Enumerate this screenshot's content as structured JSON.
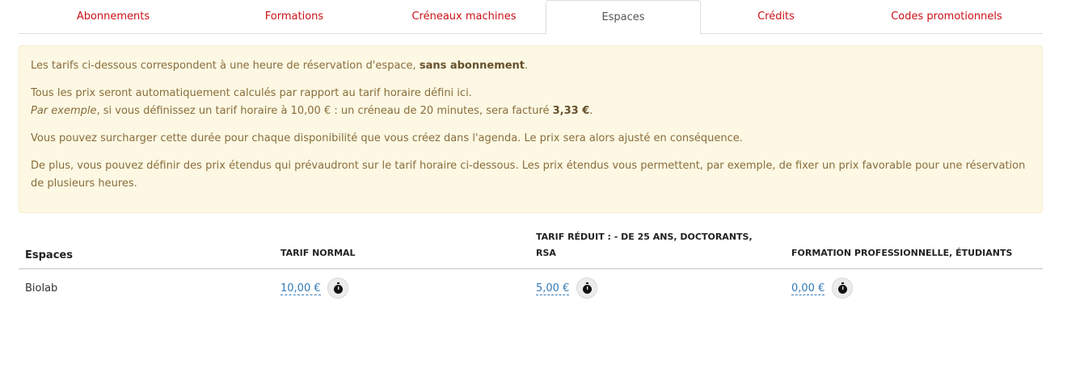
{
  "tabs": [
    {
      "label": "Abonnements",
      "active": false
    },
    {
      "label": "Formations",
      "active": false
    },
    {
      "label": "Créneaux machines",
      "active": false
    },
    {
      "label": "Espaces",
      "active": true
    },
    {
      "label": "Crédits",
      "active": false
    },
    {
      "label": "Codes promotionnels",
      "active": false
    }
  ],
  "info": {
    "p1_a": "Les tarifs ci-dessous correspondent à une heure de réservation d'espace, ",
    "p1_b": "sans abonnement",
    "p1_c": ".",
    "p2_a": "Tous les prix seront automatiquement calculés par rapport au tarif horaire défini ici.",
    "p2_b": "Par exemple",
    "p2_c": ", si vous définissez un tarif horaire à 10,00 € : un créneau de 20 minutes, sera facturé ",
    "p2_d": "3,33 €",
    "p2_e": ".",
    "p3": "Vous pouvez surcharger cette durée pour chaque disponibilité que vous créez dans l'agenda. Le prix sera alors ajusté en conséquence.",
    "p4": "De plus, vous pouvez définir des prix étendus qui prévaudront sur le tarif horaire ci-dessous. Les prix étendus vous permettent, par exemple, de fixer un prix favorable pour une réservation de plusieurs heures."
  },
  "table": {
    "headers": [
      "Espaces",
      "TARIF NORMAL",
      "TARIF RÉDUIT : - DE 25 ANS, DOCTORANTS, RSA",
      "FORMATION PROFESSIONNELLE, ÉTUDIANTS"
    ],
    "rows": [
      {
        "name": "Biolab",
        "prices": [
          "10,00 €",
          "5,00 €",
          "0,00 €"
        ]
      }
    ]
  },
  "colors": {
    "tab_text": "#cb1117",
    "alert_bg": "#fcf8e3",
    "link": "#337ab7"
  },
  "icons": {
    "price_action": "stopwatch-icon"
  }
}
